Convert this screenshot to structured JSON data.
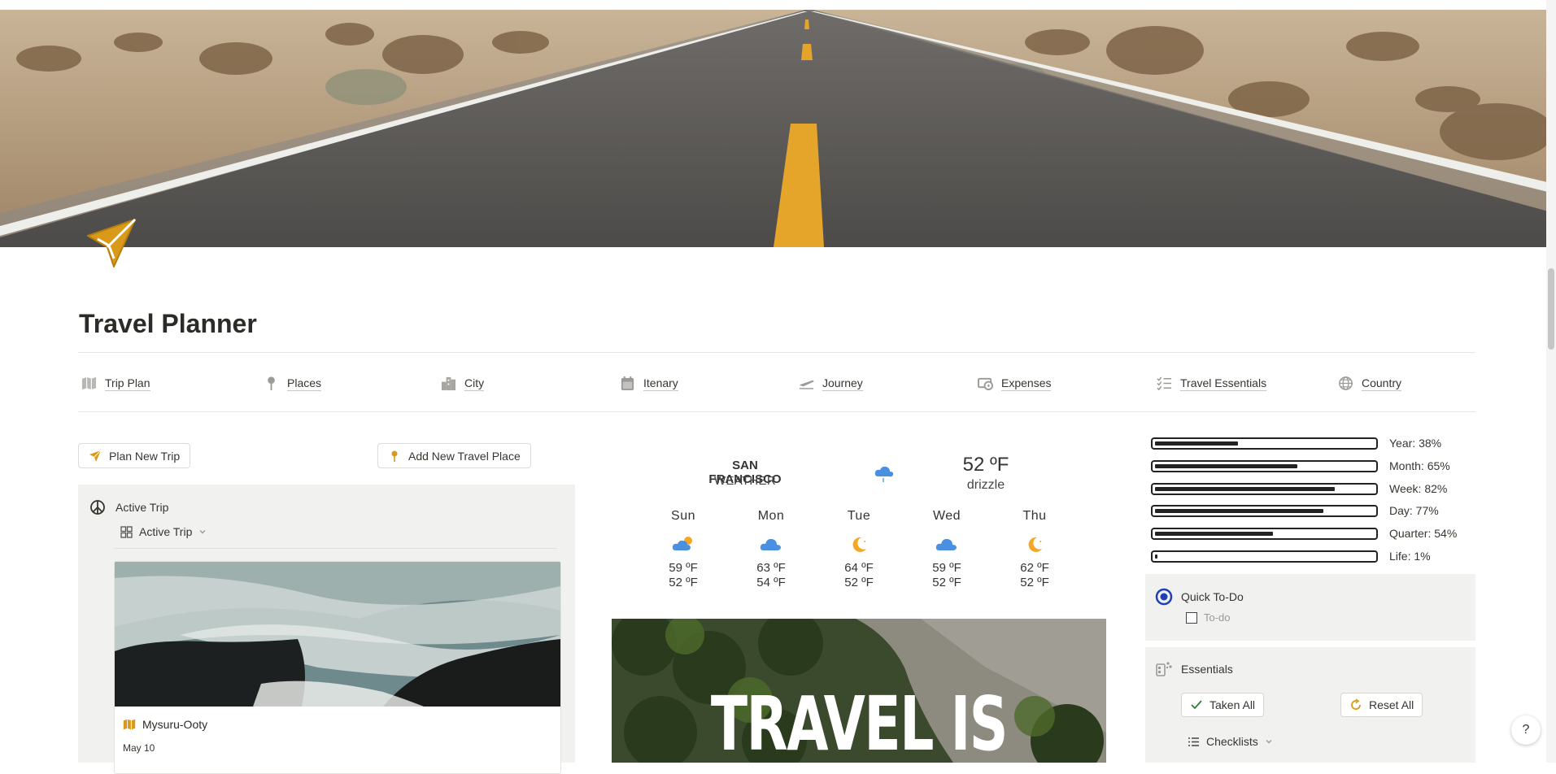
{
  "page": {
    "title": "Travel Planner"
  },
  "nav": [
    {
      "label": "Trip Plan",
      "icon": "map-icon"
    },
    {
      "label": "Places",
      "icon": "pin-icon"
    },
    {
      "label": "City",
      "icon": "buildings-icon"
    },
    {
      "label": "Itenary",
      "icon": "calendar-icon"
    },
    {
      "label": "Journey",
      "icon": "plane-icon"
    },
    {
      "label": "Expenses",
      "icon": "money-icon"
    },
    {
      "label": "Travel Essentials",
      "icon": "checklist-icon"
    },
    {
      "label": "Country",
      "icon": "globe-icon"
    }
  ],
  "buttons": {
    "plan_new_trip": "Plan New Trip",
    "add_new_place": "Add New Travel Place"
  },
  "active_trip": {
    "heading": "Active Trip",
    "view_label": "Active Trip",
    "card": {
      "name": "Mysuru-Ooty",
      "date": "May 10"
    }
  },
  "weather": {
    "city": "SAN FRANCISCO",
    "label": "WEATHER",
    "temp": "52 ºF",
    "condition": "drizzle",
    "days": [
      {
        "name": "Sun",
        "hi": "59 ºF",
        "lo": "52 ºF",
        "icon": "partly-cloudy-day-icon"
      },
      {
        "name": "Mon",
        "hi": "63 ºF",
        "lo": "54 ºF",
        "icon": "cloud-icon"
      },
      {
        "name": "Tue",
        "hi": "64 ºF",
        "lo": "52 ºF",
        "icon": "moon-icon"
      },
      {
        "name": "Wed",
        "hi": "59 ºF",
        "lo": "52 ºF",
        "icon": "cloud-icon"
      },
      {
        "name": "Thu",
        "hi": "62 ºF",
        "lo": "52 ºF",
        "icon": "moon-icon"
      }
    ]
  },
  "poster": {
    "text": "TRAVEL IS"
  },
  "progress": [
    {
      "label": "Year: 38%",
      "value": 0.38
    },
    {
      "label": "Month: 65%",
      "value": 0.65
    },
    {
      "label": "Week: 82%",
      "value": 0.82
    },
    {
      "label": "Day: 77%",
      "value": 0.77
    },
    {
      "label": "Quarter: 54%",
      "value": 0.54
    },
    {
      "label": "Life: 1%",
      "value": 0.01
    }
  ],
  "quick_todo": {
    "heading": "Quick To-Do",
    "item_placeholder": "To-do"
  },
  "essentials": {
    "heading": "Essentials",
    "taken_all": "Taken All",
    "reset_all": "Reset All",
    "checklists": "Checklists"
  },
  "colors": {
    "accent": "#d99a1c",
    "weather_blue": "#4a90e2",
    "moon_orange": "#f5a623",
    "todo_blue": "#1f3fb8"
  }
}
